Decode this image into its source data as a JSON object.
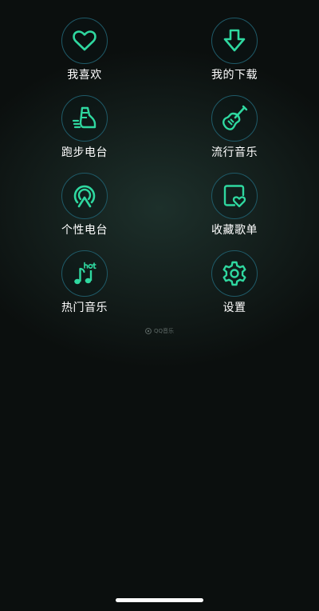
{
  "menu": {
    "favorites": {
      "label": "我喜欢",
      "icon": "heart-icon"
    },
    "downloads": {
      "label": "我的下载",
      "icon": "download-arrow-icon"
    },
    "running_radio": {
      "label": "跑步电台",
      "icon": "running-shoe-icon"
    },
    "pop_music": {
      "label": "流行音乐",
      "icon": "electric-guitar-icon"
    },
    "personal_radio": {
      "label": "个性电台",
      "icon": "radio-broadcast-icon"
    },
    "collected_playlists": {
      "label": "收藏歌单",
      "icon": "collection-heart-icon"
    },
    "hot_music": {
      "label": "热门音乐",
      "icon": "hot-music-note-icon"
    },
    "settings": {
      "label": "设置",
      "icon": "gear-icon"
    }
  },
  "footer": {
    "brand_text": "QQ音乐",
    "brand_icon": "qq-music-logo-icon"
  },
  "colors": {
    "accent": "#2fd8a0",
    "ring": "#1f5a68",
    "text": "#ffffff"
  }
}
